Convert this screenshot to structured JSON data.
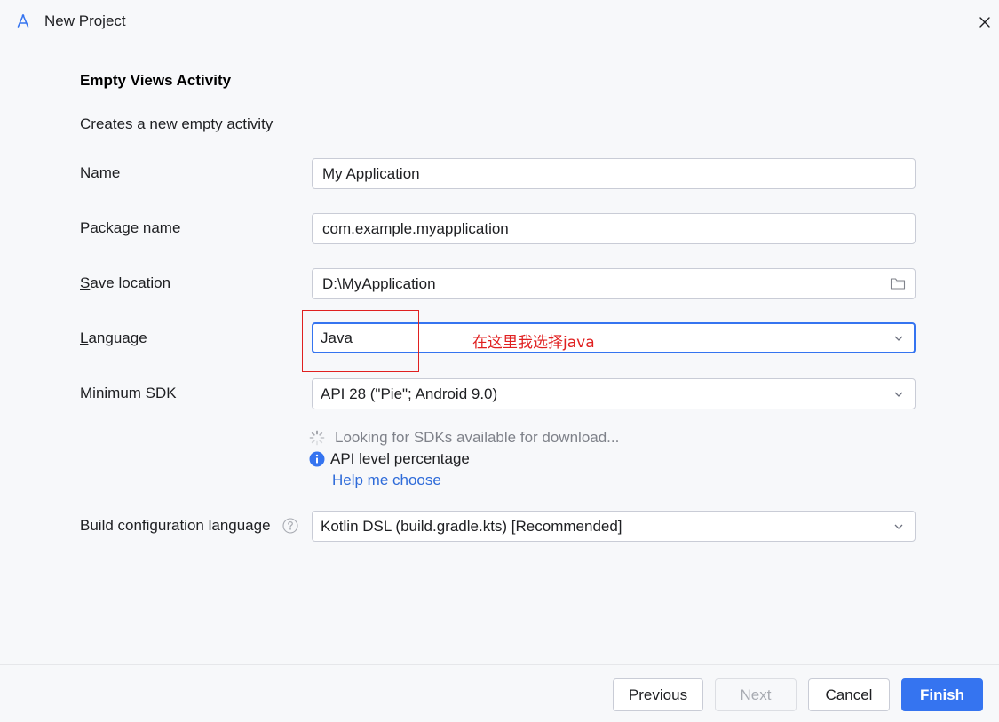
{
  "window": {
    "title": "New Project",
    "logo_icon": "android-studio-logo-icon",
    "close_icon": "close-icon"
  },
  "form": {
    "heading": "Empty Views Activity",
    "description": "Creates a new empty activity",
    "name": {
      "label_mnemonic": "N",
      "label_rest": "ame",
      "value": "My Application"
    },
    "package": {
      "label_mnemonic": "P",
      "label_rest": "ackage name",
      "value": "com.example.myapplication"
    },
    "save_location": {
      "label_mnemonic": "S",
      "label_rest": "ave location",
      "value": "D:\\MyApplication",
      "icon": "folder-icon"
    },
    "language": {
      "label_mnemonic": "L",
      "label_rest": "anguage",
      "value": "Java"
    },
    "min_sdk": {
      "label": "Minimum SDK",
      "value": "API 28 (\"Pie\"; Android 9.0)"
    },
    "sdk_status": {
      "loading_text": "Looking for SDKs available for download...",
      "api_level_text": "API level percentage",
      "help_link": "Help me choose"
    },
    "build_config": {
      "label": "Build configuration language",
      "value": "Kotlin DSL (build.gradle.kts) [Recommended]"
    }
  },
  "annotation": {
    "text": "在这里我选择java",
    "color": "#e02020"
  },
  "footer": {
    "previous": "Previous",
    "next": "Next",
    "cancel": "Cancel",
    "finish": "Finish"
  },
  "colors": {
    "accent": "#3574f0",
    "link": "#2e6bd9",
    "background": "#f7f8fa"
  }
}
